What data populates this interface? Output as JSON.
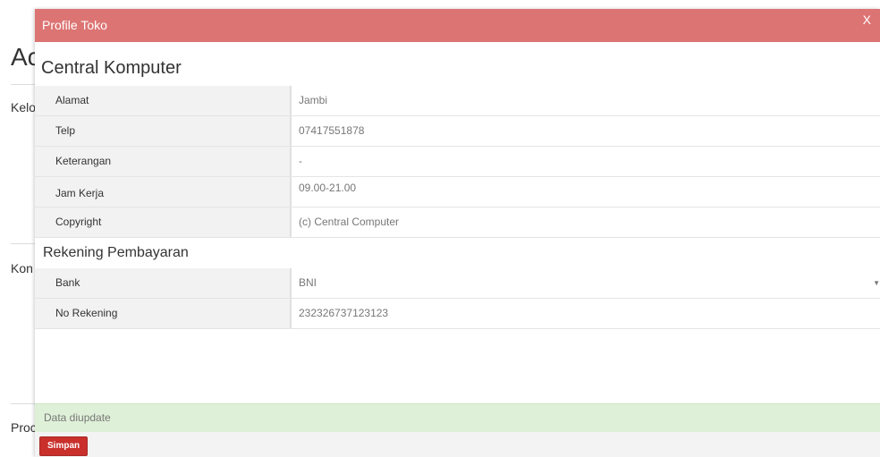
{
  "background": {
    "title_fragment": "Ac",
    "labels": [
      "Kelo",
      "Kon",
      "Proc"
    ]
  },
  "modal": {
    "title": "Profile Toko",
    "close_label": "X",
    "shop_name": "Central Komputer",
    "profile_rows": [
      {
        "label": "Alamat",
        "value": "Jambi"
      },
      {
        "label": "Telp",
        "value": "07417551878"
      },
      {
        "label": "Keterangan",
        "value": "-"
      },
      {
        "label": "Jam Kerja",
        "value": "09.00-21.00"
      },
      {
        "label": "Copyright",
        "value": "(c) Central Computer"
      }
    ],
    "payment_section_title": "Rekening Pembayaran",
    "payment_rows": [
      {
        "label": "Bank",
        "value": "BNI"
      },
      {
        "label": "No Rekening",
        "value": "232326737123123"
      }
    ],
    "alert_text": "Data diupdate",
    "save_label": "Simpan"
  },
  "colors": {
    "header": "#dc7473",
    "alert_bg": "#dff0d8",
    "button": "#c9302c"
  }
}
